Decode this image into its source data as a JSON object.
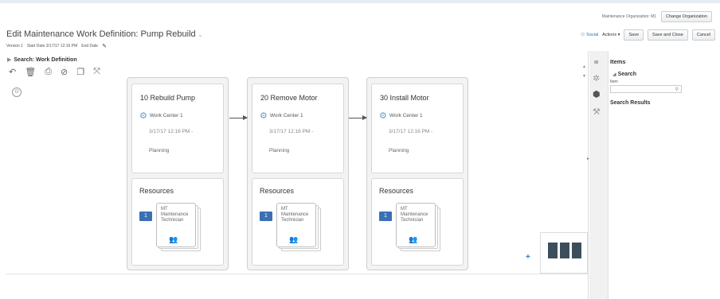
{
  "header": {
    "org_text": "Maintenance Organization: M1",
    "change_org_label": "Change Organization",
    "title": "Edit Maintenance Work Definition: Pump Rebuild",
    "version": "Version 1",
    "start_date": "Start Date 3/17/17 12:16 PM",
    "end_date": "End Date",
    "social_label": "Social",
    "actions_label": "Actions",
    "save_label": "Save",
    "save_close_label": "Save and Close",
    "cancel_label": "Cancel"
  },
  "search": {
    "title": "Search: Work Definition"
  },
  "toolbar": {
    "icons": [
      "undo-icon",
      "delete-icon",
      "print-icon",
      "check-icon",
      "copy-icon",
      "expand-icon"
    ]
  },
  "operations": [
    {
      "title": "10 Rebuild Pump",
      "work_center": "Work Center 1",
      "date": "3/17/17 12:16 PM -",
      "status": "Planning",
      "resources_title": "Resources",
      "qty": "1",
      "resource_name": "MT Maintenance Technician"
    },
    {
      "title": "20 Remove Motor",
      "work_center": "Work Center 1",
      "date": "3/17/17 12:16 PM -",
      "status": "Planning",
      "resources_title": "Resources",
      "qty": "1",
      "resource_name": "MT Maintenance Technician"
    },
    {
      "title": "30 Install Motor",
      "work_center": "Work Center 1",
      "date": "3/17/17 12:16 PM -",
      "status": "Planning",
      "resources_title": "Resources",
      "qty": "1",
      "resource_name": "MT Maintenance Technician"
    }
  ],
  "items_panel": {
    "title": "Items",
    "search_title": "Search",
    "field_label": "Item",
    "results_title": "Search Results"
  },
  "colors": {
    "accent": "#3b6fb6",
    "minimap": "#3c4e5c",
    "workcenter_icon": "#6a9cc4"
  }
}
